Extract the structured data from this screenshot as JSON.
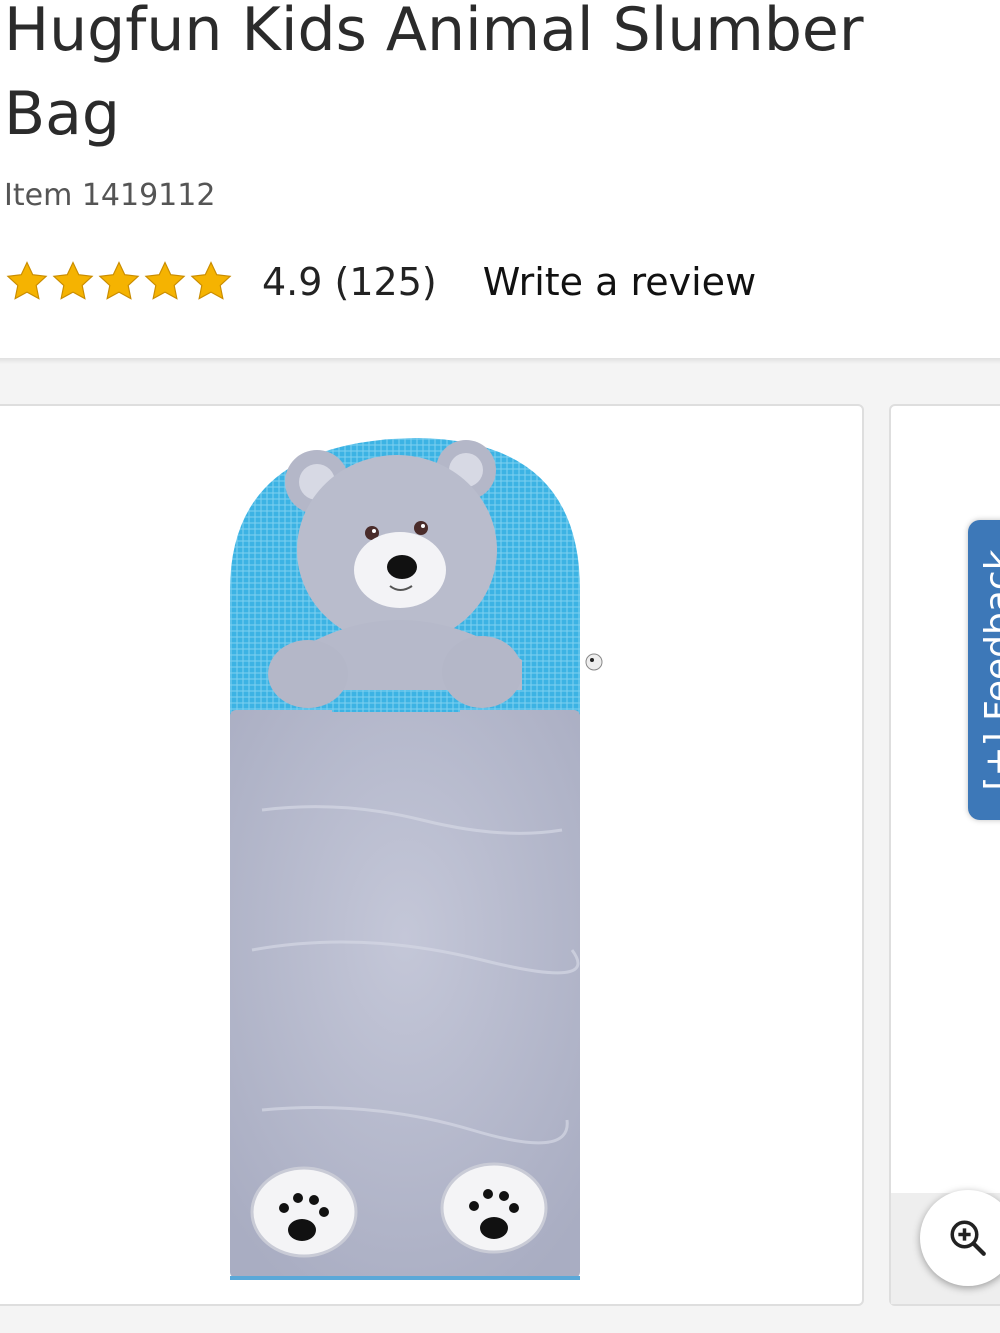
{
  "product": {
    "title": "Hugfun Kids Animal Slumber Bag",
    "item_number": "Item 1419112"
  },
  "rating": {
    "stars": 5,
    "text": "4.9 (125)",
    "write_review": "Write a review"
  },
  "gallery": {
    "image_subject": "bear-slumber-bag",
    "zoom_icon": "zoom-in-icon"
  },
  "feedback": {
    "label": "[+] Feedback"
  },
  "colors": {
    "star": "#f5b301",
    "feedback_tab": "#3d78b8",
    "bag_blue": "#3cb3e4",
    "bag_grey": "#b9bcd0"
  }
}
